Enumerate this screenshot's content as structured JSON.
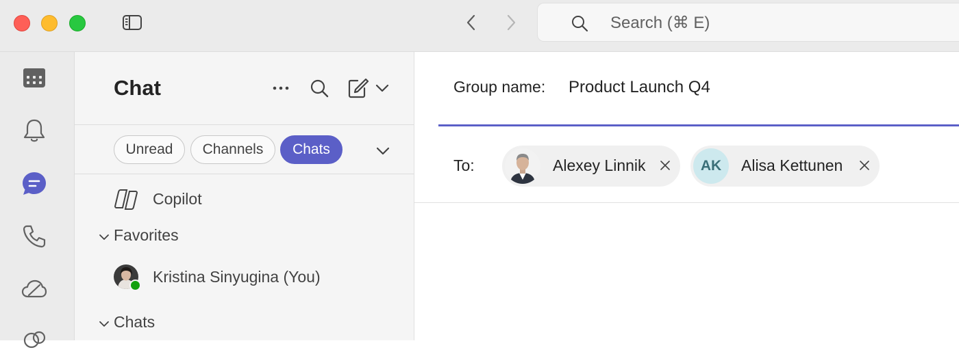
{
  "titlebar": {
    "search_placeholder": "Search (⌘ E)"
  },
  "rail": {
    "items": [
      {
        "icon": "calendar-icon"
      },
      {
        "icon": "bell-icon"
      },
      {
        "icon": "chat-icon",
        "active": true
      },
      {
        "icon": "phone-icon"
      },
      {
        "icon": "cloud-icon"
      },
      {
        "icon": "apps-icon"
      }
    ]
  },
  "chat_list": {
    "title": "Chat",
    "filters": [
      {
        "label": "Unread",
        "active": false
      },
      {
        "label": "Channels",
        "active": false
      },
      {
        "label": "Chats",
        "active": true
      }
    ],
    "copilot_label": "Copilot",
    "favorites_label": "Favorites",
    "favorite_contact": "Kristina Sinyugina (You)",
    "chats_label": "Chats"
  },
  "compose": {
    "group_name_label": "Group name:",
    "group_name_value": "Product Launch Q4",
    "to_label": "To:",
    "recipients": [
      {
        "name": "Alexey Linnik",
        "initials": ""
      },
      {
        "name": "Alisa Kettunen",
        "initials": "AK"
      }
    ]
  },
  "colors": {
    "accent": "#5b5fc7",
    "presence": "#13a10e"
  }
}
